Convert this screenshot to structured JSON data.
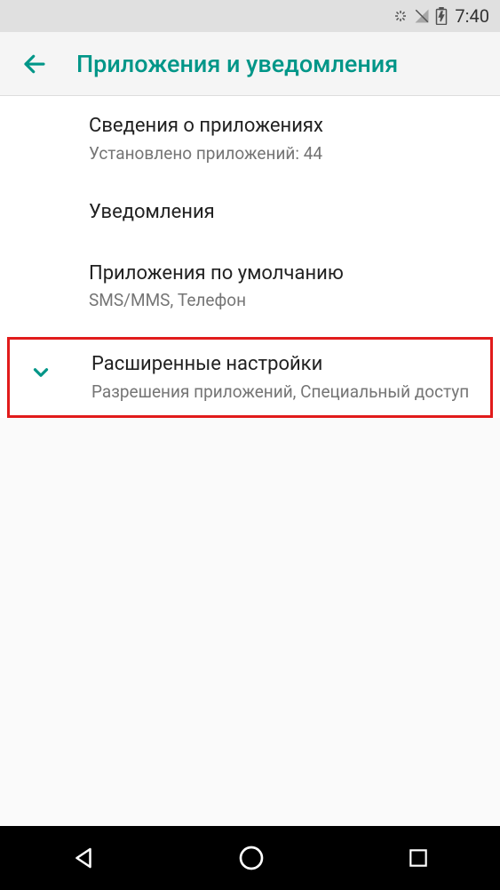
{
  "statusBar": {
    "time": "7:40"
  },
  "header": {
    "title": "Приложения и уведомления"
  },
  "settings": {
    "appInfo": {
      "title": "Сведения о приложениях",
      "subtitle": "Установлено приложений: 44"
    },
    "notifications": {
      "title": "Уведомления"
    },
    "defaultApps": {
      "title": "Приложения по умолчанию",
      "subtitle": "SMS/MMS, Телефон"
    },
    "advanced": {
      "title": "Расширенные настройки",
      "subtitle": "Разрешения приложений, Специальный доступ"
    }
  }
}
